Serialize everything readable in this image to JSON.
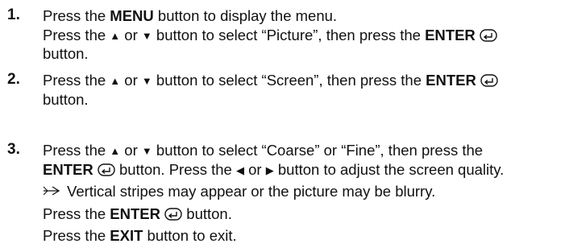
{
  "steps": [
    {
      "number": "1.",
      "lines": [
        [
          "Press the ",
          {
            "b": "MENU"
          },
          " button to display the menu."
        ],
        [
          "Press the ",
          {
            "icon": "up-triangle"
          },
          " or ",
          {
            "icon": "down-triangle"
          },
          " button to select “Picture”, then press the ",
          {
            "b": "ENTER"
          },
          " ",
          {
            "icon": "enter-icon"
          }
        ],
        [
          "button."
        ]
      ]
    },
    {
      "number": "2.",
      "lines": [
        [
          "Press the ",
          {
            "icon": "up-triangle"
          },
          " or ",
          {
            "icon": "down-triangle"
          },
          " button to select “Screen”, then press the ",
          {
            "b": "ENTER"
          },
          " ",
          {
            "icon": "enter-icon"
          }
        ],
        [
          "button."
        ]
      ]
    },
    {
      "number": "3.",
      "lines": [
        [
          "Press the ",
          {
            "icon": "up-triangle"
          },
          " or ",
          {
            "icon": "down-triangle"
          },
          " button to select “Coarse” or “Fine”, then press the"
        ],
        [
          {
            "b": "ENTER"
          },
          " ",
          {
            "icon": "enter-icon"
          },
          " button. Press the ",
          {
            "icon": "left-triangle"
          },
          " or ",
          {
            "icon": "right-triangle"
          },
          " button to adjust the screen quality."
        ],
        [
          {
            "icon": "note-arrow-icon"
          },
          "Vertical stripes may appear or the picture may be blurry."
        ],
        [
          "Press the ",
          {
            "b": "ENTER"
          },
          " ",
          {
            "icon": "enter-icon"
          },
          " button."
        ],
        [
          "Press the ",
          {
            "b": "EXIT"
          },
          " button to exit."
        ]
      ]
    }
  ]
}
